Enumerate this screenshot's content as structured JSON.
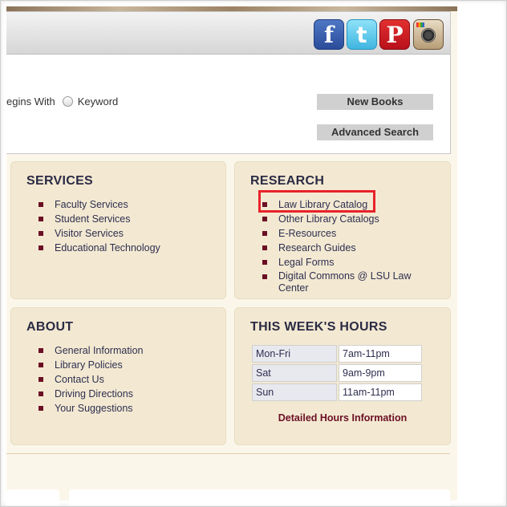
{
  "social": {
    "facebook_glyph": "f",
    "twitter_glyph": "t",
    "pinterest_glyph": "P"
  },
  "search": {
    "begins_with_label": "egins With",
    "keyword_label": "Keyword",
    "new_books_label": "New Books",
    "advanced_search_label": "Advanced Search"
  },
  "services": {
    "title": "SERVICES",
    "items": [
      "Faculty Services",
      "Student Services",
      "Visitor Services",
      "Educational Technology"
    ]
  },
  "research": {
    "title": "RESEARCH",
    "items": [
      "Law Library Catalog",
      "Other Library Catalogs",
      "E-Resources",
      "Research Guides",
      "Legal Forms",
      "Digital Commons @ LSU Law Center"
    ]
  },
  "about": {
    "title": "ABOUT",
    "items": [
      "General Information",
      "Library Policies",
      "Contact Us",
      "Driving Directions",
      "Your Suggestions"
    ]
  },
  "hours": {
    "title": "THIS WEEK'S HOURS",
    "rows": [
      {
        "day": "Mon-Fri",
        "time": "7am-11pm"
      },
      {
        "day": "Sat",
        "time": "9am-9pm"
      },
      {
        "day": "Sun",
        "time": "11am-11pm"
      }
    ],
    "link_label": "Detailed Hours Information"
  },
  "colors": {
    "accent": "#6b0f24",
    "box_bg": "#f3e9d2",
    "highlight": "#e8222a"
  }
}
